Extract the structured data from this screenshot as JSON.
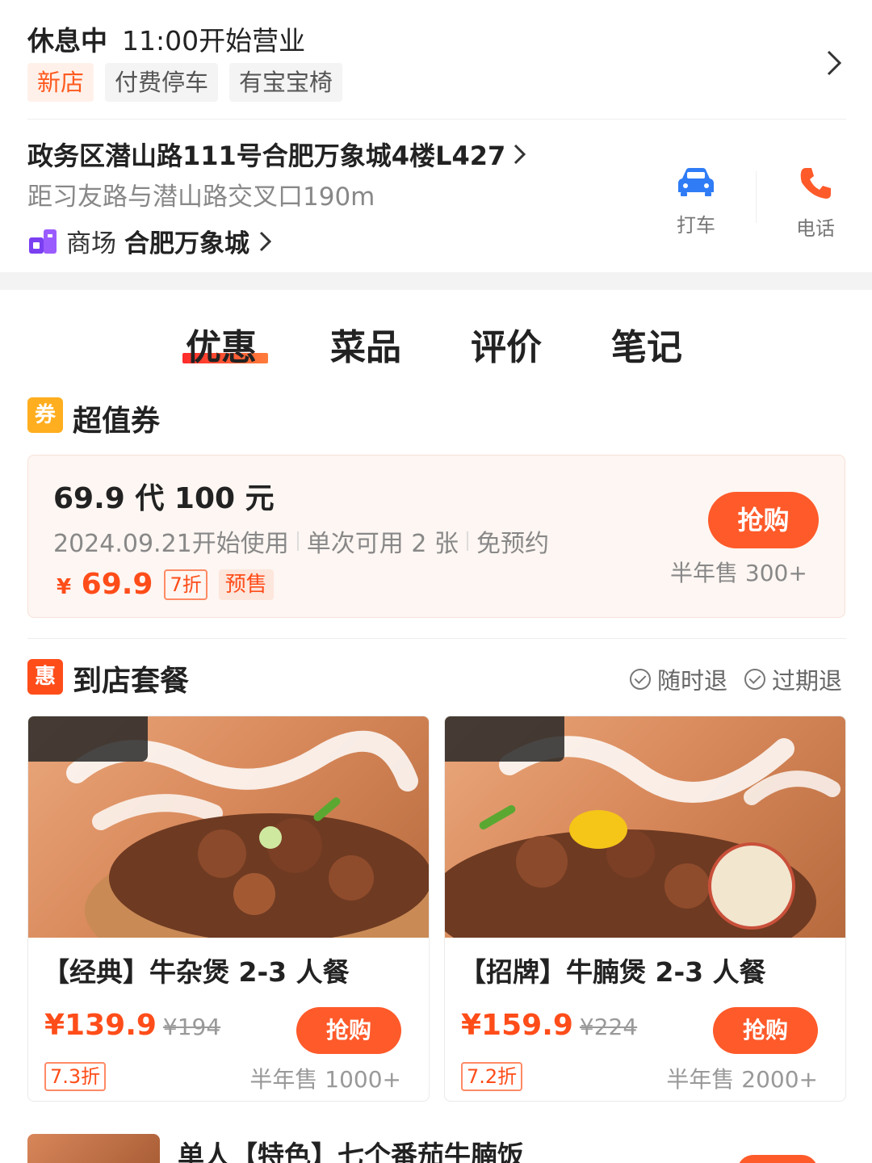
{
  "store": {
    "status": "休息中",
    "open_time": "11:00开始营业",
    "tags": [
      "新店",
      "付费停车",
      "有宝宝椅"
    ],
    "address": "政务区潜山路111号合肥万象城4楼L427",
    "distance": "距习友路与潜山路交叉口190m",
    "mall_label": "商场",
    "mall_name": "合肥万象城"
  },
  "actions": {
    "taxi_label": "打车",
    "phone_label": "电话"
  },
  "tabs": [
    "优惠",
    "菜品",
    "评价",
    "笔记"
  ],
  "coupon_section": {
    "icon_text": "券",
    "title": "超值券",
    "voucher": {
      "title": "69.9 代 100 元",
      "start": "2024.09.21开始使用",
      "usage": "单次可用 2 张",
      "reservation": "免预约",
      "currency": "¥",
      "price": "69.9",
      "discount": "7折",
      "presale": "预售",
      "buy_label": "抢购",
      "sold": "半年售 300+"
    }
  },
  "meal_section": {
    "icon_text": "惠",
    "title": "到店套餐",
    "policy": [
      "随时退",
      "过期退"
    ],
    "items": [
      {
        "name": "【经典】牛杂煲 2-3 人餐",
        "price": "¥139.9",
        "orig": "¥194",
        "discount": "7.3折",
        "sold": "半年售 1000+",
        "buy_label": "抢购"
      },
      {
        "name": "【招牌】牛腩煲 2-3 人餐",
        "price": "¥159.9",
        "orig": "¥224",
        "discount": "7.2折",
        "sold": "半年售 2000+",
        "buy_label": "抢购"
      }
    ],
    "next_item": "单人【特色】七个番茄牛腩饭"
  },
  "colors": {
    "accent": "#ff5a2a",
    "price": "#ff4d1a",
    "taxi": "#2f7cf6",
    "phone": "#ff5a2a",
    "mall": "#7b3ff2"
  }
}
